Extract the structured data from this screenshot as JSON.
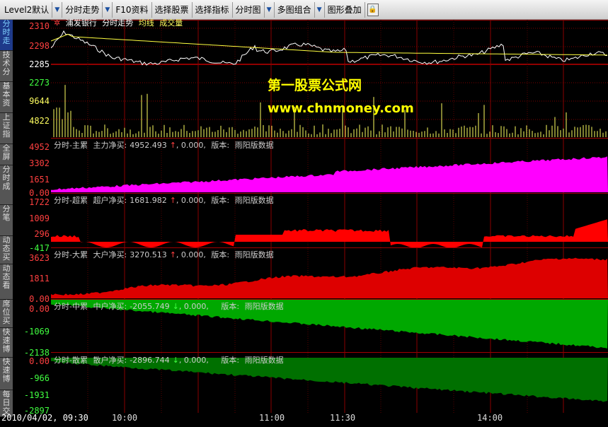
{
  "toolbar": {
    "items": [
      "Level2默认",
      "分时走势",
      "F10资料",
      "选择股票",
      "选择指标",
      "分时图",
      "多图组合",
      "图形叠加"
    ]
  },
  "sidebar": {
    "tabs": [
      "分时走",
      "技术分",
      "基本资",
      "上证指",
      "全屏",
      "分时成",
      "分笔",
      "动态买",
      "动态看",
      "席位买",
      "快速博",
      "快速博",
      "每日交"
    ]
  },
  "header": {
    "stock_name": "浦发银行",
    "chart_name": "分时走势",
    "avg_label": "均线",
    "vol_label": "成交量"
  },
  "price_axis": {
    "top": "2310",
    "upper": "2298",
    "mid": "2285",
    "lower": "2273",
    "vol_high": "9644",
    "vol_low": "4822"
  },
  "panels": [
    {
      "title": "分时-主累",
      "label": "主力净买:",
      "value": "4952.493",
      "arrow": "↑",
      "rest": ", 0.000,",
      "ver": "版本:",
      "ver_text": "雨阳版数据",
      "ticks": [
        "4952",
        "3302",
        "1651",
        "0.00"
      ],
      "color": "#ff00ff"
    },
    {
      "title": "分时-超累",
      "label": "超户净买:",
      "value": "1681.982",
      "arrow": "↑",
      "rest": ", 0.000,",
      "ver": "版本:",
      "ver_text": "雨阳版数据",
      "ticks": [
        "1722",
        "1009",
        "296",
        "-417"
      ],
      "color": "#ff0000"
    },
    {
      "title": "分时-大累",
      "label": "大户净买:",
      "value": "3270.513",
      "arrow": "↑",
      "rest": ", 0.000,",
      "ver": "版本:",
      "ver_text": "雨阳版数据",
      "ticks": [
        "3623",
        "1811",
        "0.00"
      ],
      "color": "#dd0000"
    },
    {
      "title": "分时-中累",
      "label": "中户净买:",
      "value": "-2055.749",
      "arrow": "↓",
      "rest": ", 0.000,",
      "ver": "版本:",
      "ver_text": "雨阳版数据",
      "ticks": [
        "0.00",
        "-1069",
        "-2138"
      ],
      "color": "#00aa00"
    },
    {
      "title": "分时-散累",
      "label": "散户净买:",
      "value": "-2896.744",
      "arrow": "↓",
      "rest": ", 0.000,",
      "ver": "版本:",
      "ver_text": "雨阳版数据",
      "ticks": [
        "0.00",
        "-966",
        "-1931",
        "-2897"
      ],
      "color": "#007a00"
    }
  ],
  "status": {
    "date": "2010/04/02, 09:30",
    "times": [
      "10:00",
      "11:00",
      "11:30",
      "14:00"
    ]
  },
  "watermark": {
    "line1": "第一股票公式网",
    "line2": "www.chnmoney.com"
  }
}
